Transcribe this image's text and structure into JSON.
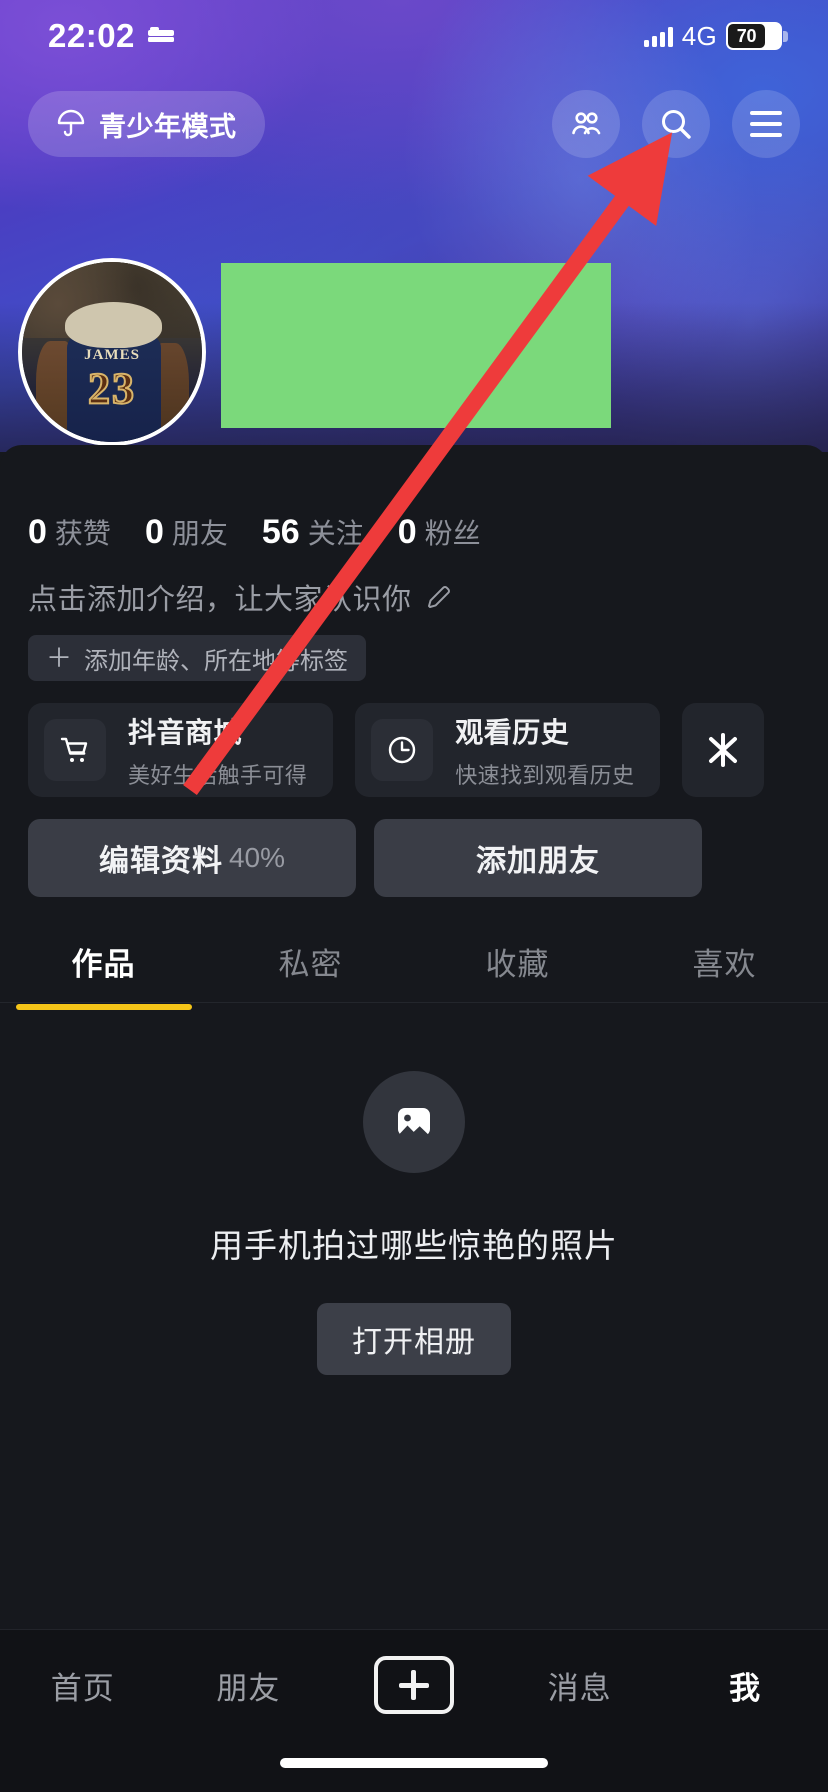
{
  "status_bar": {
    "time": "22:02",
    "sleep_icon": "bed-icon",
    "network": "4G",
    "battery_level": "70",
    "signal_icon": "signal-bars-icon"
  },
  "header": {
    "teen_mode_label": "青少年模式",
    "teen_mode_icon": "umbrella-icon",
    "friends_icon": "friends-icon",
    "search_icon": "search-icon",
    "menu_icon": "hamburger-menu-icon"
  },
  "profile": {
    "avatar_icon": "avatar",
    "avatar_jersey_name": "JAMES",
    "avatar_jersey_number": "23",
    "username_redacted": true,
    "stats": [
      {
        "value": "0",
        "label": "获赞"
      },
      {
        "value": "0",
        "label": "朋友"
      },
      {
        "value": "56",
        "label": "关注"
      },
      {
        "value": "0",
        "label": "粉丝"
      }
    ],
    "bio_placeholder": "点击添加介绍，让大家认识你",
    "bio_edit_icon": "pencil-icon",
    "tag_chip_label": "添加年龄、所在地等标签",
    "tag_chip_plus": "＋"
  },
  "service_cards": [
    {
      "title": "抖音商城",
      "subtitle": "美好生活触手可得",
      "icon": "shopping-cart-icon"
    },
    {
      "title": "观看历史",
      "subtitle": "快速找到观看历史",
      "icon": "clock-icon"
    }
  ],
  "service_card_mini": {
    "icon": "douyin-spark-icon"
  },
  "actions": {
    "edit_profile_label": "编辑资料",
    "edit_profile_percent": "40%",
    "add_friend_label": "添加朋友"
  },
  "tabs": [
    {
      "label": "作品",
      "active": true
    },
    {
      "label": "私密",
      "active": false
    },
    {
      "label": "收藏",
      "active": false
    },
    {
      "label": "喜欢",
      "active": false
    }
  ],
  "empty_state": {
    "icon": "image-placeholder-icon",
    "text": "用手机拍过哪些惊艳的照片",
    "button_label": "打开相册"
  },
  "bottom_nav": {
    "items": [
      {
        "label": "首页",
        "active": false
      },
      {
        "label": "朋友",
        "active": false
      },
      {
        "label": "消息",
        "active": false
      },
      {
        "label": "我",
        "active": true
      }
    ],
    "create_icon": "plus-icon"
  },
  "annotation": {
    "arrow_color": "#ee3b3b",
    "arrow_from": "编辑资料 button",
    "arrow_to": "hamburger-menu-icon"
  },
  "colors": {
    "accent_yellow": "#f5c518",
    "sheet_bg": "#16181d",
    "card_bg": "#22252c",
    "button_bg": "#3a3d46",
    "redaction_green": "#7bd97b",
    "arrow_red": "#ee3b3b"
  }
}
